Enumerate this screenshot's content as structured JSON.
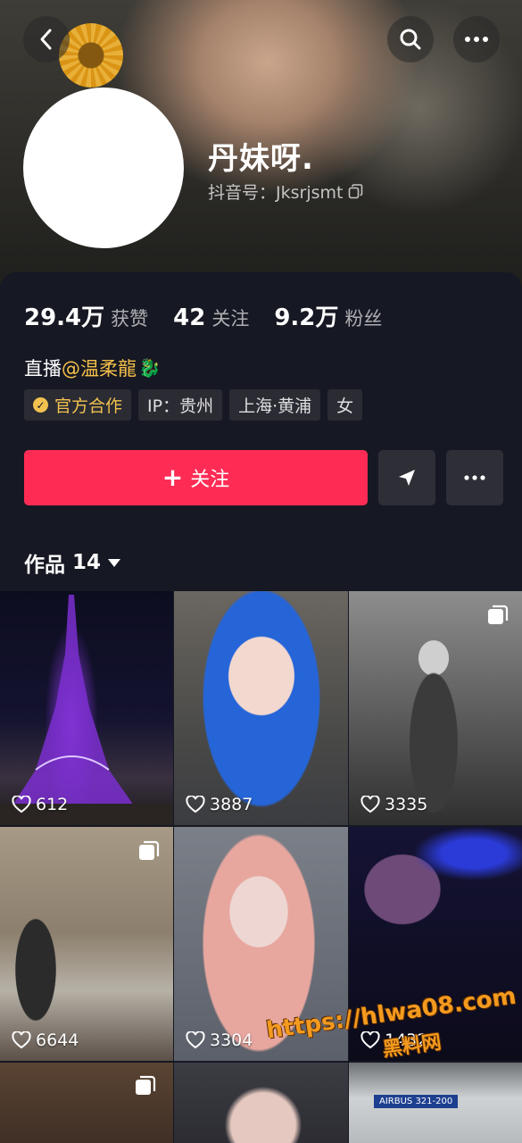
{
  "profile": {
    "nickname": "丹妹呀.",
    "douyin_id": "抖音号：Jksrjsmt"
  },
  "stats": {
    "likes_num": "29.4万",
    "likes_label": "获赞",
    "following_num": "42",
    "following_label": "关注",
    "followers_num": "9.2万",
    "followers_label": "粉丝"
  },
  "bio": {
    "prefix": "直播",
    "mention": "@温柔龍",
    "emoji": "🐉"
  },
  "tags": {
    "official": "官方合作",
    "ip": "IP：贵州",
    "location": "上海·黄浦",
    "gender": "女"
  },
  "actions": {
    "follow_label": "关注"
  },
  "works": {
    "label": "作品",
    "count": "14"
  },
  "videos": [
    {
      "likes": "612"
    },
    {
      "likes": "3887"
    },
    {
      "likes": "3335"
    },
    {
      "likes": "6644"
    },
    {
      "likes": "3304"
    },
    {
      "likes": "1432"
    },
    {
      "likes": ""
    },
    {
      "likes": ""
    },
    {
      "likes": ""
    }
  ],
  "video_texts": {
    "airbus_label": "AIRBUS 321-200"
  },
  "watermark": {
    "url": "https://hlwa08.com",
    "name": "黑料网"
  },
  "colors": {
    "background": "#161823",
    "follow_button": "#fe2c55",
    "mention": "#f5c04a",
    "official_tag": "#f2c14f"
  }
}
